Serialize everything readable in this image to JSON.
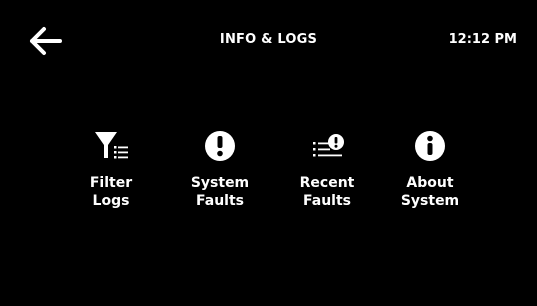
{
  "header": {
    "title": "INFO & LOGS",
    "time": "12:12 PM",
    "back_icon": "arrow-left-icon"
  },
  "menu": [
    {
      "line1": "Filter",
      "line2": "Logs",
      "icon": "filter-list-icon"
    },
    {
      "line1": "System",
      "line2": "Faults",
      "icon": "exclamation-circle-icon"
    },
    {
      "line1": "Recent",
      "line2": "Faults",
      "icon": "list-alert-icon"
    },
    {
      "line1": "About",
      "line2": "System",
      "icon": "info-circle-icon"
    }
  ],
  "colors": {
    "background": "#000000",
    "foreground": "#ffffff"
  }
}
